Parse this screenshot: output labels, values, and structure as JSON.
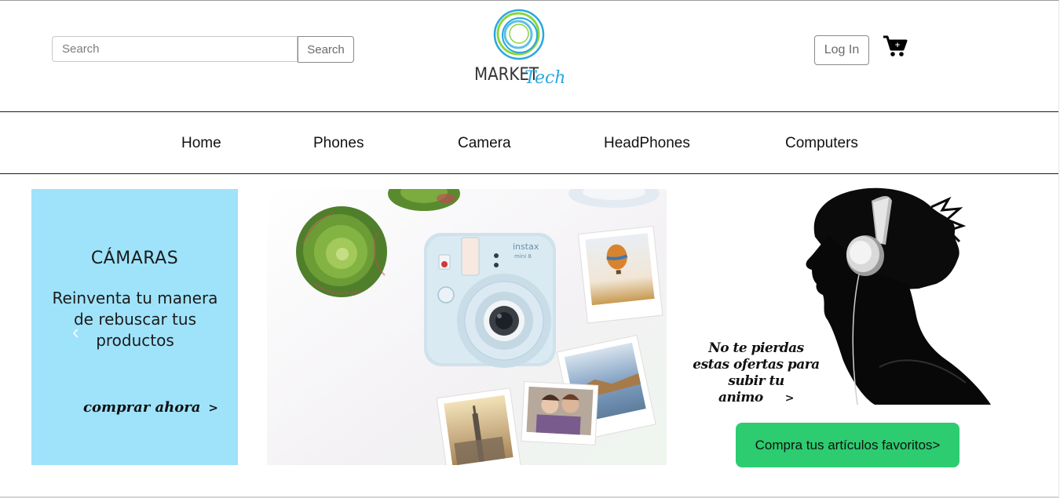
{
  "header": {
    "search_placeholder": "Search",
    "search_button": "Search",
    "logo_word1": "MARKET",
    "logo_word2": "Tech",
    "login_button": "Log In"
  },
  "nav": {
    "items": [
      "Home",
      "Phones",
      "Camera",
      "HeadPhones",
      "Computers"
    ]
  },
  "banners": {
    "cameras": {
      "title": "CÁMARAS",
      "text": "Reinventa tu manera de rebuscar tus productos",
      "cta": "comprar ahora",
      "cta_arrow": ">"
    },
    "camera_photo": {
      "brand": "instax",
      "model": "mini 8"
    },
    "headphones": {
      "text": "No te pierdas estas ofertas para subir tu animo",
      "arrow": ">"
    },
    "favorites_button": "Compra tus artículos favoritos>"
  },
  "colors": {
    "cameras_bg": "#9fe3fb",
    "favorites_button": "#2dcc70",
    "logo_blue": "#2aa7e0",
    "logo_green": "#8cd63c"
  },
  "icons": {
    "cart": "shopping-cart-icon",
    "carousel_prev": "chevron-left-icon"
  }
}
